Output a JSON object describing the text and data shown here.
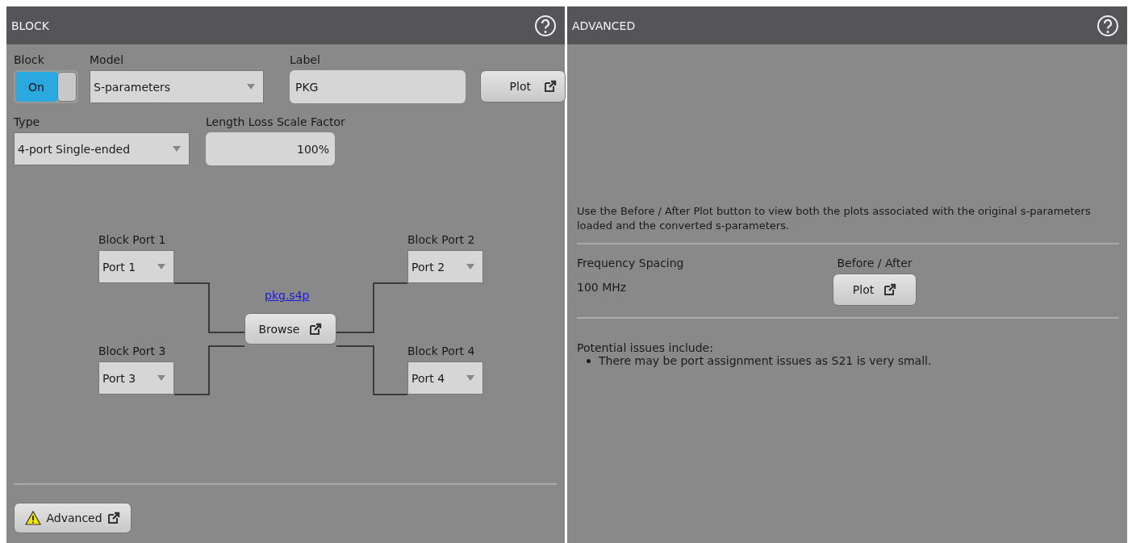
{
  "block_panel": {
    "title": "BLOCK",
    "block": {
      "label": "Block",
      "toggle_text": "On",
      "on": true
    },
    "model": {
      "label": "Model",
      "value": "S-parameters"
    },
    "label_field": {
      "label": "Label",
      "value": "PKG"
    },
    "plot_button": "Plot",
    "type": {
      "label": "Type",
      "value": "4-port Single-ended"
    },
    "length_loss": {
      "label": "Length Loss Scale Factor",
      "value": "100%"
    },
    "ports": [
      {
        "label": "Block Port 1",
        "value": "Port 1"
      },
      {
        "label": "Block Port 2",
        "value": "Port 2"
      },
      {
        "label": "Block Port 3",
        "value": "Port 3"
      },
      {
        "label": "Block Port 4",
        "value": "Port 4"
      }
    ],
    "file_link": "pkg.s4p",
    "browse_button": "Browse",
    "advanced_button": "Advanced"
  },
  "advanced_panel": {
    "title": "ADVANCED",
    "description": "Use the Before / After Plot button to view both the plots associated with the original s-parameters loaded and the converted s-parameters.",
    "frequency_spacing": {
      "label": "Frequency Spacing",
      "value": "100 MHz"
    },
    "before_after": {
      "label": "Before / After",
      "button": "Plot"
    },
    "issues_title": "Potential issues include:",
    "issues": [
      "There may be port assignment issues as S21 is very small."
    ]
  }
}
